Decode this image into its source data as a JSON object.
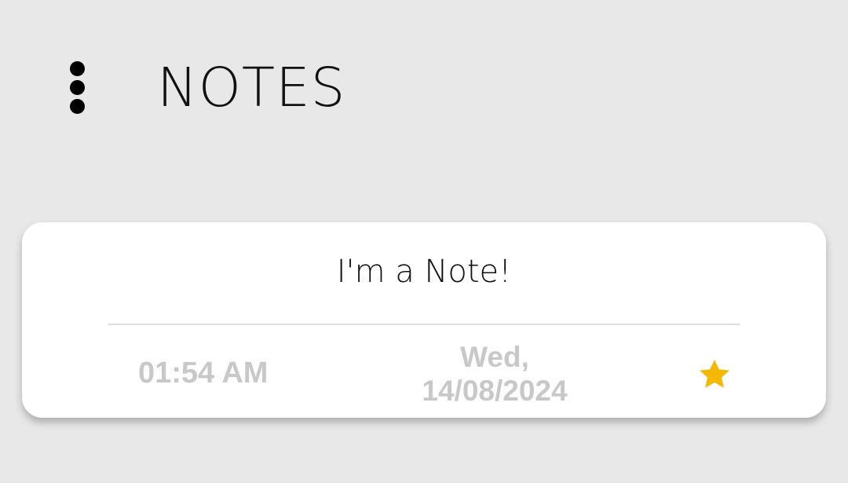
{
  "header": {
    "title": "NOTES",
    "menu_icon": "more-vertical-icon"
  },
  "notes": [
    {
      "title": "I'm a Note!",
      "time": "01:54 AM",
      "date_day": "Wed,",
      "date": "14/08/2024",
      "starred": true,
      "star_icon": "star-icon"
    }
  ],
  "colors": {
    "background": "#e8e8e8",
    "card": "#ffffff",
    "meta_text": "#c8c8c8",
    "star": "#f5b800"
  }
}
